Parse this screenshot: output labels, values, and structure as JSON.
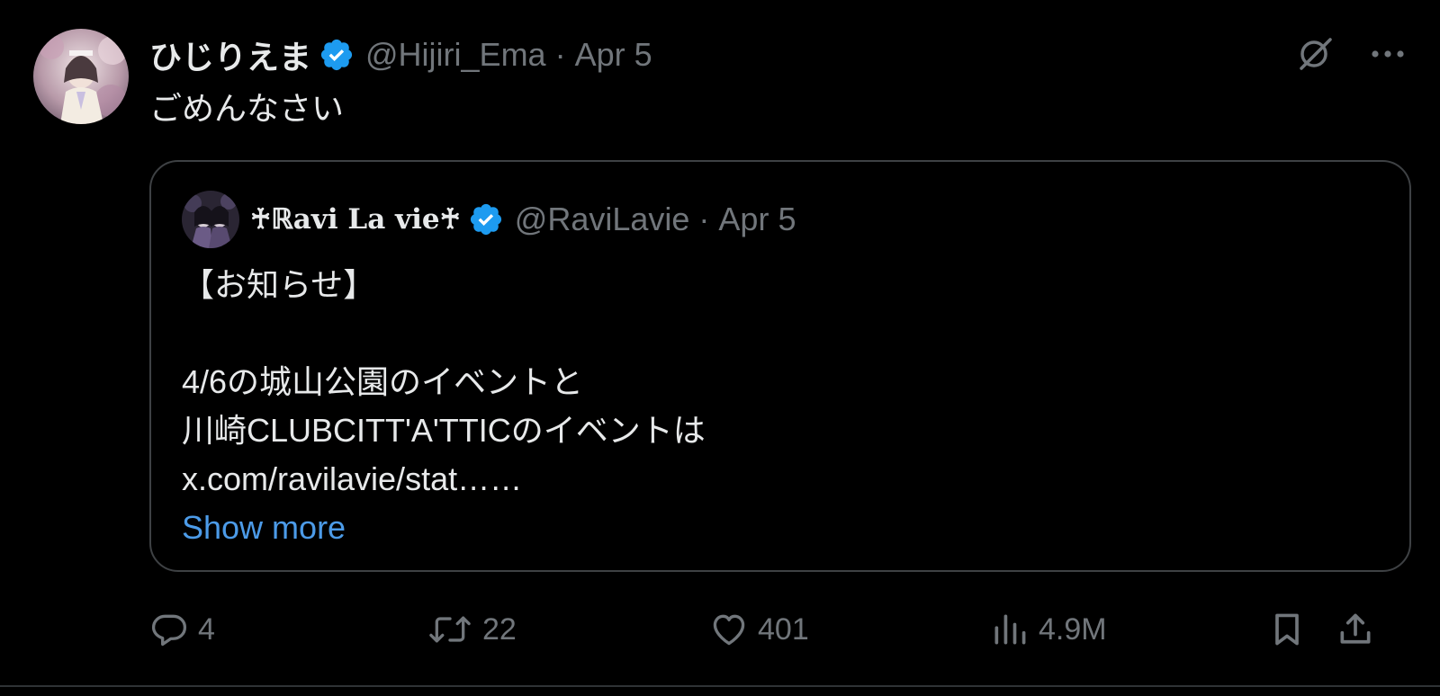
{
  "author": {
    "display_name": "ひじりえま",
    "handle": "@Hijiri_Ema",
    "separator": "·",
    "date": "Apr 5",
    "verified_icon": "verified-badge-icon",
    "avatar_colors": [
      "#d9c6cf",
      "#a58aa6",
      "#efe8e3"
    ]
  },
  "tweet": {
    "text": "ごめんなさい"
  },
  "top_actions": {
    "grok_icon": "grok-icon",
    "more_icon": "more-icon"
  },
  "quote": {
    "display_name": "♰ℝavi La vie♰",
    "handle": "@RaviLavie",
    "separator": "·",
    "date": "Apr 5",
    "lines": [
      "【お知らせ】",
      "",
      "4/6の城山公園のイベントと",
      "川崎CLUBCITT'A'TTICのイベントは",
      "x.com/ravilavie/stat……"
    ],
    "show_more": "Show more",
    "avatar_colors": [
      "#3a3446",
      "#6b5b86",
      "#1a1620"
    ]
  },
  "actions": {
    "reply_count": "4",
    "retweet_count": "22",
    "like_count": "401",
    "views_count": "4.9M",
    "icons": [
      "reply-icon",
      "retweet-icon",
      "like-icon",
      "views-icon",
      "bookmark-icon",
      "share-icon"
    ]
  },
  "colors": {
    "background": "#000000",
    "text": "#e7e9ea",
    "muted": "#71767b",
    "link": "#4c9be8",
    "verified": "#1d9bf0",
    "border": "#3e4144"
  }
}
